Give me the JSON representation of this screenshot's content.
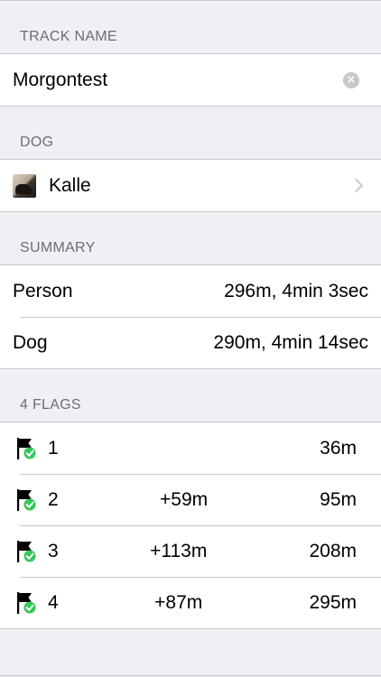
{
  "track": {
    "header": "TRACK NAME",
    "name": "Morgontest",
    "clear_symbol": "×"
  },
  "dog": {
    "header": "DOG",
    "name": "Kalle",
    "avatar_icon": "dog-photo",
    "chevron_icon": "chevron-right-icon"
  },
  "summary": {
    "header": "SUMMARY",
    "rows": [
      {
        "label": "Person",
        "value": "296m, 4min 3sec"
      },
      {
        "label": "Dog",
        "value": "290m, 4min 14sec"
      }
    ]
  },
  "flags": {
    "header": "4 FLAGS",
    "icon": "flag-check-icon",
    "colors": {
      "flag": "#000000",
      "check": "#34c759"
    },
    "items": [
      {
        "number": "1",
        "delta": "",
        "distance": "36m"
      },
      {
        "number": "2",
        "delta": "+59m",
        "distance": "95m"
      },
      {
        "number": "3",
        "delta": "+113m",
        "distance": "208m"
      },
      {
        "number": "4",
        "delta": "+87m",
        "distance": "295m"
      }
    ]
  }
}
